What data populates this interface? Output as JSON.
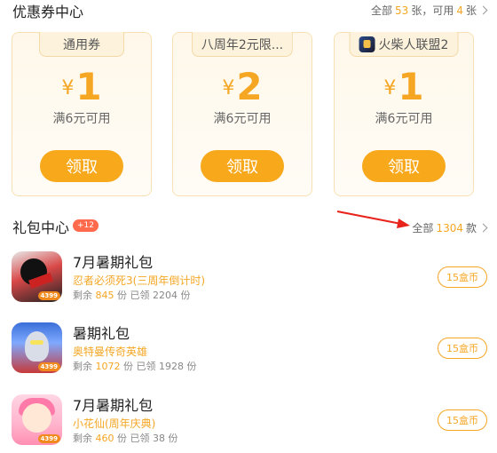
{
  "coupon_center": {
    "title": "优惠券中心",
    "summary_prefix": "全部",
    "total_count": "53",
    "summary_mid": "张，可用",
    "available_count": "4",
    "summary_suffix": "张",
    "coupons": [
      {
        "tag": "通用券",
        "currency": "¥",
        "amount": "1",
        "condition": "满6元可用",
        "button": "领取"
      },
      {
        "tag": "八周年2元限...",
        "currency": "¥",
        "amount": "2",
        "condition": "满6元可用",
        "button": "领取"
      },
      {
        "tag": "火柴人联盟2",
        "currency": "¥",
        "amount": "1",
        "condition": "满6元可用",
        "button": "领取",
        "tag_icon": "game-icon"
      }
    ]
  },
  "gift_center": {
    "title": "礼包中心",
    "badge": "+12",
    "summary_prefix": "全部",
    "total_count": "1304",
    "summary_suffix": "款",
    "items": [
      {
        "name": "7月暑期礼包",
        "game": "忍者必须死3(三周年倒计时)",
        "remain_label": "剩余",
        "remain": "845",
        "unit1": "份 已领",
        "claimed": "2204",
        "unit2": "份",
        "price": "15盒币",
        "logo": "4399"
      },
      {
        "name": "暑期礼包",
        "game": "奥特曼传奇英雄",
        "remain_label": "剩余",
        "remain": "1072",
        "unit1": "份 已领",
        "claimed": "1928",
        "unit2": "份",
        "price": "15盒币",
        "logo": "4399"
      },
      {
        "name": "7月暑期礼包",
        "game": "小花仙(周年庆典)",
        "remain_label": "剩余",
        "remain": "460",
        "unit1": "份 已领",
        "claimed": "38",
        "unit2": "份",
        "price": "15盒币",
        "logo": "4399"
      }
    ]
  },
  "colors": {
    "accent": "#f5a623",
    "button": "#f7a81b",
    "badge": "#ff6a4d",
    "annotation_arrow": "#e8231c"
  }
}
